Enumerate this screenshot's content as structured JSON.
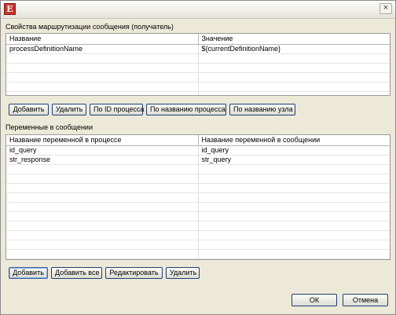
{
  "titlebar": {
    "icon_glyph": "E",
    "close_glyph": "×"
  },
  "routing_section": {
    "label": "Свойства маршрутизации сообщения (получатель)",
    "columns": [
      "Название",
      "Значение"
    ],
    "rows": [
      [
        "processDefinitionName",
        "${currentDefinitionName}"
      ]
    ],
    "buttons": {
      "add": "Добавить",
      "delete": "Удалить",
      "by_process_id": "По ID процесса",
      "by_process_name": "По названию процесса",
      "by_node_name": "По названию узла"
    }
  },
  "variables_section": {
    "label": "Переменные в сообщении",
    "columns": [
      "Название переменной в процессе",
      "Название переменной в сообщении"
    ],
    "rows": [
      [
        "id_query",
        "id_query"
      ],
      [
        "str_response",
        "str_query"
      ]
    ],
    "buttons": {
      "add": "Добавить",
      "add_all": "Добавить все",
      "edit": "Редактировать",
      "delete": "Удалить"
    }
  },
  "footer": {
    "ok": "ОК",
    "cancel": "Отмена"
  }
}
